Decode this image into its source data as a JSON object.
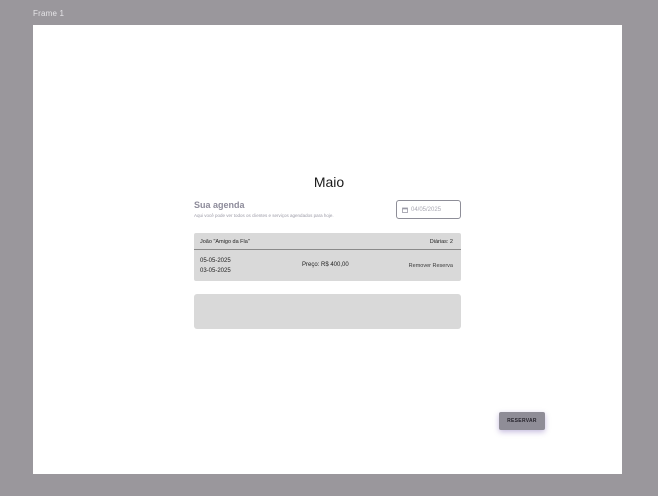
{
  "frame": {
    "label": "Frame 1"
  },
  "calendar": {
    "month": "Maio"
  },
  "agenda": {
    "title": "Sua agenda",
    "subtitle": "Aqui você pode ver todos os clientes e serviços agendados para hoje.",
    "date_value": "04/05/2025",
    "date_icon": "calendar-icon"
  },
  "reservations": [
    {
      "name": "João \"Amigo da Fla\"",
      "diarias": "Diárias: 2",
      "date_start": "05-05-2025",
      "date_end": "03-05-2025",
      "price": "Preço:  R$ 400,00",
      "remove_label": "Remover Reserva"
    }
  ],
  "actions": {
    "reserve_label": "RESERVAR"
  }
}
